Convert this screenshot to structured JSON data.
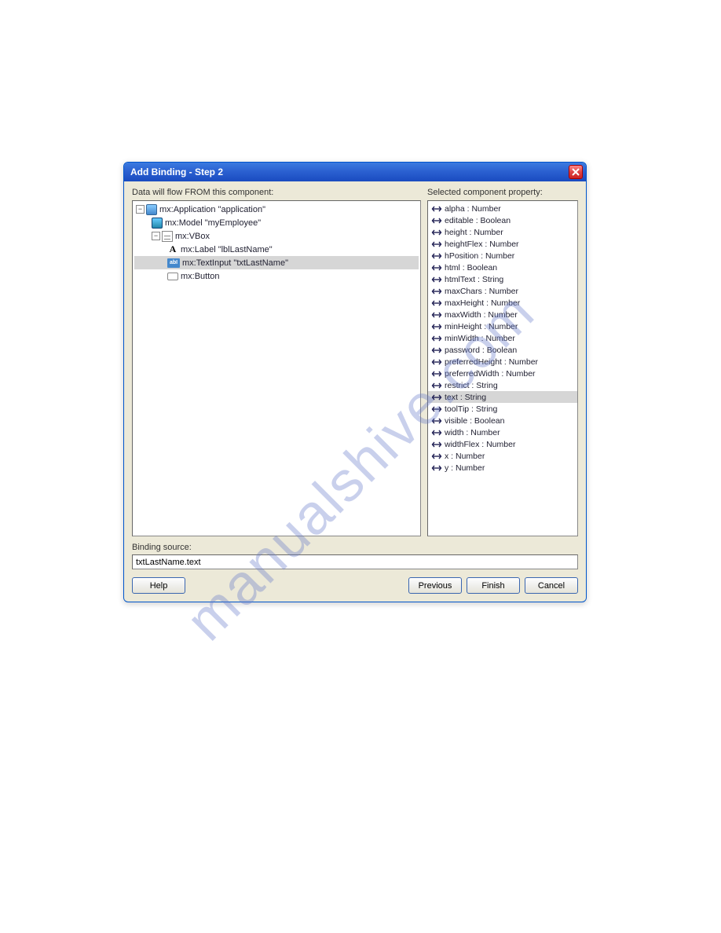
{
  "title": "Add Binding - Step 2",
  "left_label": "Data will flow FROM this component:",
  "right_label": "Selected component property:",
  "tree": {
    "root": "mx:Application \"application\"",
    "model": "mx:Model \"myEmployee\"",
    "vbox": "mx:VBox",
    "label": "mx:Label \"lblLastName\"",
    "textinput": "mx:TextInput \"txtLastName\"",
    "button": "mx:Button"
  },
  "props": [
    "alpha : Number",
    "editable : Boolean",
    "height : Number",
    "heightFlex : Number",
    "hPosition : Number",
    "html : Boolean",
    "htmlText : String",
    "maxChars : Number",
    "maxHeight : Number",
    "maxWidth : Number",
    "minHeight : Number",
    "minWidth : Number",
    "password : Boolean",
    "preferredHeight : Number",
    "preferredWidth : Number",
    "restrict : String",
    "text : String",
    "toolTip : String",
    "visible : Boolean",
    "width : Number",
    "widthFlex : Number",
    "x : Number",
    "y : Number"
  ],
  "selected_prop_index": 16,
  "binding_label": "Binding source:",
  "binding_value": "txtLastName.text",
  "buttons": {
    "help": "Help",
    "previous": "Previous",
    "finish": "Finish",
    "cancel": "Cancel"
  },
  "watermark": "manualshive.com"
}
